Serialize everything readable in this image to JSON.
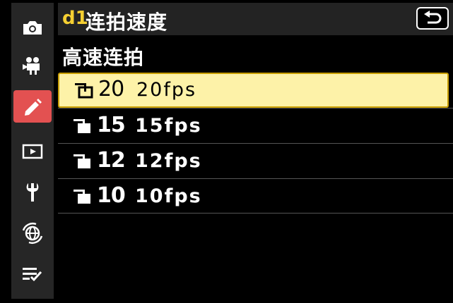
{
  "sidebar": {
    "tabs": [
      {
        "name": "photo-shooting-menu",
        "icon": "camera-icon",
        "active": false
      },
      {
        "name": "movie-recording-menu",
        "icon": "movie-camera-icon",
        "active": false
      },
      {
        "name": "custom-settings-menu",
        "icon": "pencil-icon",
        "active": true
      },
      {
        "name": "playback-menu",
        "icon": "playback-icon",
        "active": false
      },
      {
        "name": "setup-menu",
        "icon": "wrench-icon",
        "active": false
      },
      {
        "name": "network-menu",
        "icon": "network-icon",
        "active": false
      },
      {
        "name": "my-menu",
        "icon": "list-check-icon",
        "active": false
      }
    ]
  },
  "header": {
    "code": "d1",
    "title": "连拍速度",
    "back_icon": "return-arrow-icon"
  },
  "subheading": "高速连拍",
  "options": [
    {
      "code": "20",
      "label": "20fps",
      "selected": true
    },
    {
      "code": "15",
      "label": "15fps",
      "selected": false
    },
    {
      "code": "12",
      "label": "12fps",
      "selected": false
    },
    {
      "code": "10",
      "label": "10fps",
      "selected": false
    }
  ],
  "colors": {
    "accent_yellow": "#f5cf32",
    "active_tab": "#e35151",
    "selected_row": "#fdf2a8",
    "selected_border": "#c79d00"
  }
}
